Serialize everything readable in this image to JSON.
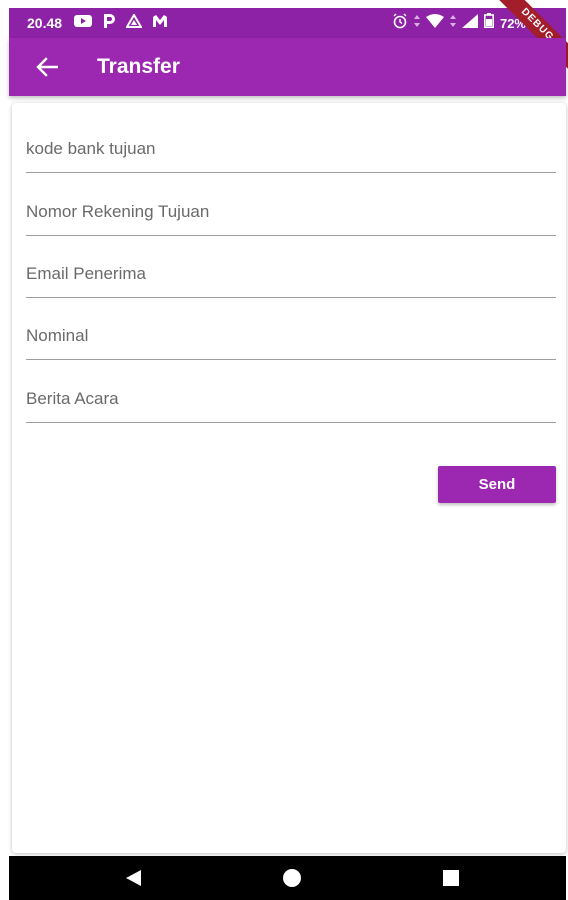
{
  "status_bar": {
    "time": "20.48",
    "battery": "72%",
    "debug_label": "DEBUG",
    "icons_left": [
      "youtube-icon",
      "p-icon",
      "triangle-icon",
      "m-icon"
    ],
    "icons_right": [
      "alarm-icon",
      "wifi-icon",
      "signal-icon",
      "battery-icon"
    ]
  },
  "app_bar": {
    "title": "Transfer",
    "back_icon": "arrow-left-icon"
  },
  "form": {
    "bank_code_placeholder": "kode bank tujuan",
    "account_number_placeholder": "Nomor Rekening Tujuan",
    "email_placeholder": "Email Penerima",
    "amount_placeholder": "Nominal",
    "note_placeholder": "Berita Acara",
    "send_label": "Send"
  },
  "nav_bar": {
    "icons": [
      "back-triangle-icon",
      "home-circle-icon",
      "recents-square-icon"
    ]
  },
  "colors": {
    "primary": "#9c27b0",
    "status_bar": "#8d22a6",
    "debug_ribbon": "#a31d2a"
  }
}
